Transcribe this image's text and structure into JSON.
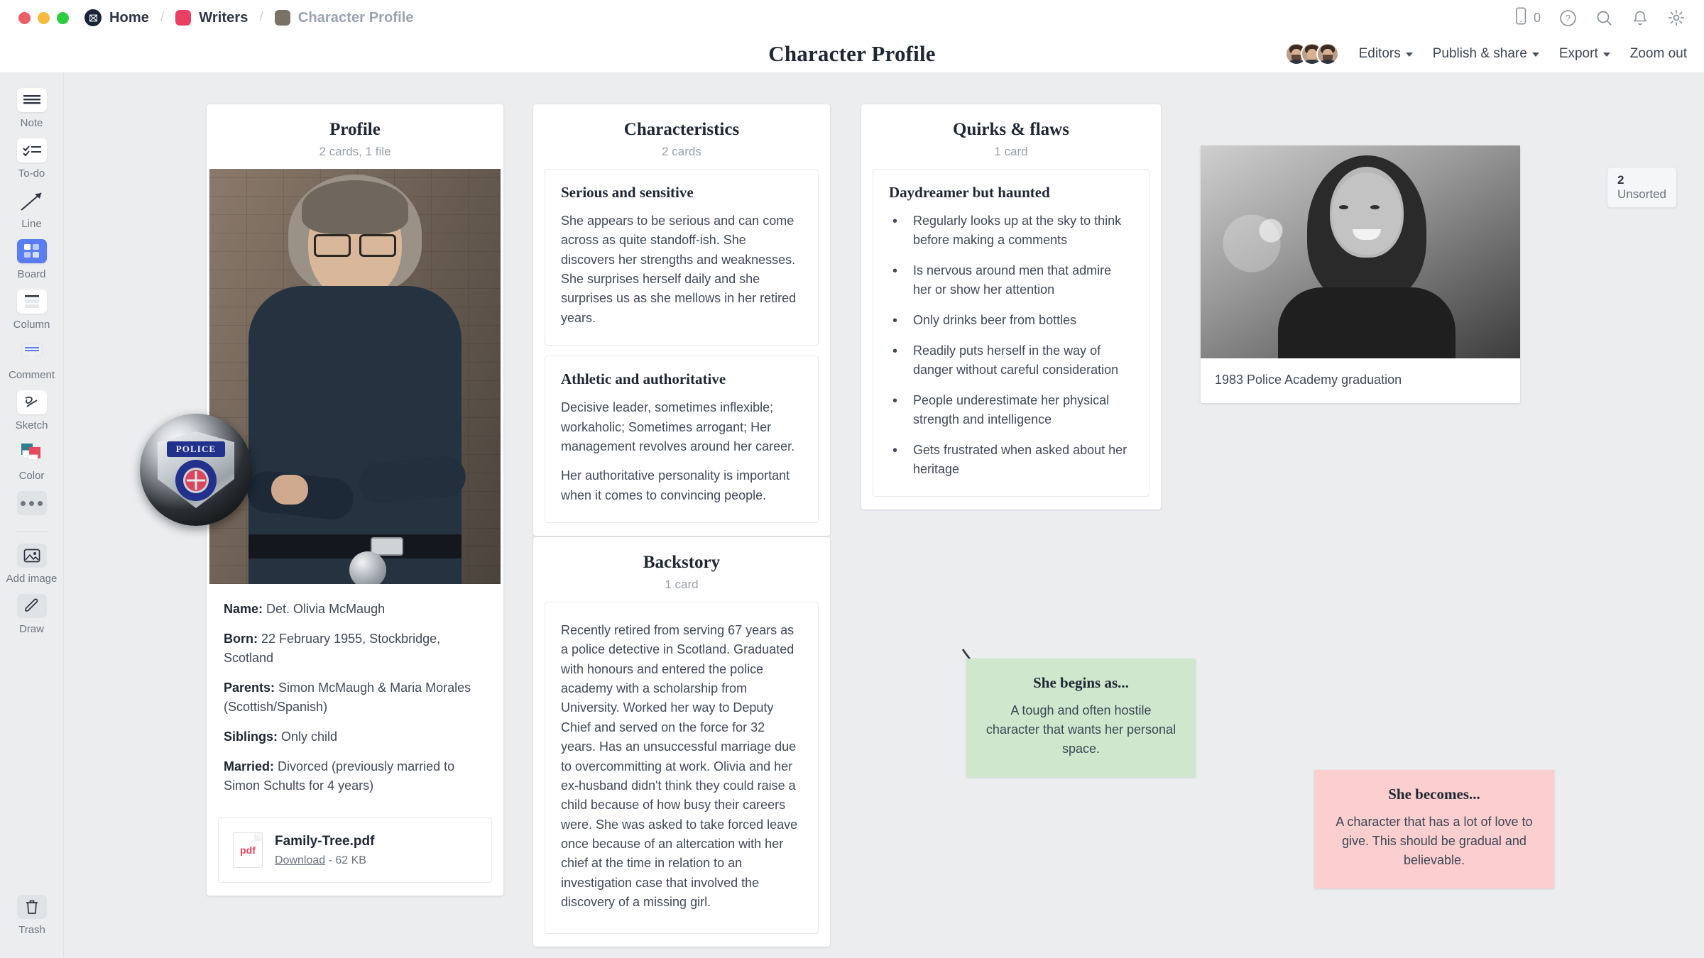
{
  "window": {
    "traffic_lights": [
      "close",
      "minimize",
      "maximize"
    ]
  },
  "breadcrumb": {
    "home": "Home",
    "project": "Writers",
    "current": "Character Profile",
    "separator": "/"
  },
  "topbar_icons": {
    "device_count": "0",
    "help": "help-icon",
    "search": "search-icon",
    "notifications": "bell-icon",
    "settings": "gear-icon"
  },
  "header": {
    "title": "Character Profile",
    "editors": "Editors",
    "publish": "Publish & share",
    "export": "Export",
    "zoom": "Zoom out"
  },
  "toolbar": {
    "items": [
      {
        "label": "Note",
        "icon": "note-icon"
      },
      {
        "label": "To-do",
        "icon": "todo-icon"
      },
      {
        "label": "Line",
        "icon": "line-icon"
      },
      {
        "label": "Board",
        "icon": "board-icon"
      },
      {
        "label": "Column",
        "icon": "column-icon"
      },
      {
        "label": "Comment",
        "icon": "comment-icon"
      },
      {
        "label": "Sketch",
        "icon": "sketch-icon"
      },
      {
        "label": "Color",
        "icon": "color-icon"
      }
    ],
    "more": "more-icon",
    "add_image": "Add image",
    "draw": "Draw",
    "trash": "Trash"
  },
  "board": {
    "unsorted_count": "2",
    "unsorted_label": "Unsorted"
  },
  "columns": [
    {
      "title": "Profile",
      "subtitle": "2 cards, 1 file",
      "meta": [
        {
          "label": "Name:",
          "value": "Det. Olivia McMaugh"
        },
        {
          "label": "Born:",
          "value": "22 February 1955, Stockbridge, Scotland"
        },
        {
          "label": "Parents:",
          "value": "Simon McMaugh & Maria Morales (Scottish/Spanish)"
        },
        {
          "label": "Siblings:",
          "value": "Only child"
        },
        {
          "label": "Married:",
          "value": "Divorced (previously married to Simon Schults for 4 years)"
        }
      ],
      "file": {
        "type": "pdf",
        "name": "Family-Tree.pdf",
        "download": "Download",
        "size": "62 KB",
        "separator": " - "
      }
    },
    {
      "title": "Characteristics",
      "subtitle": "2 cards",
      "cards": [
        {
          "title": "Serious and sensitive",
          "paragraphs": [
            "She appears to be serious and can come across as quite standoff-ish. She discovers her strengths and weaknesses. She surprises herself daily and she surprises us as she mellows in her retired years."
          ]
        },
        {
          "title": "Athletic and authoritative",
          "paragraphs": [
            "Decisive leader, sometimes inflexible; workaholic; Sometimes arrogant; Her management revolves around her career.",
            "Her authoritative personality is important when it comes to convincing people."
          ]
        }
      ]
    },
    {
      "title": "Backstory",
      "subtitle": "1 card",
      "cards": [
        {
          "title": "",
          "paragraphs": [
            "Recently retired from serving 67 years as a police detective in Scotland. Graduated with honours and entered the police academy with a scholarship from University. Worked her way to Deputy Chief and served on the force for 32 years. Has an unsuccessful marriage due to overcommitting at work. Olivia and her ex-husband didn't think they could raise a child because of how busy their careers were. She was asked to take forced leave once because of an altercation with her chief at the time in relation to an investigation case that involved the discovery of a missing girl."
          ]
        }
      ]
    },
    {
      "title": "Quirks & flaws",
      "subtitle": "1 card",
      "cards": [
        {
          "title": "Daydreamer but haunted",
          "bullets": [
            "Regularly looks up at the sky to think before making a comments",
            "Is nervous around men that admire her or show her attention",
            "Only drinks beer from bottles",
            "Readily puts herself in the way of danger without careful consideration",
            "People underestimate her physical strength and intelligence",
            "Gets frustrated when asked about her heritage"
          ]
        }
      ]
    }
  ],
  "photo_card": {
    "caption": "1983 Police Academy graduation"
  },
  "stickies": [
    {
      "title": "She begins as...",
      "body": "A tough and often hostile character that wants her personal space.",
      "color": "#cfe8cd"
    },
    {
      "title": "She becomes...",
      "body": "A character that has a lot of love to give. This should be gradual and believable.",
      "color": "#fbcfd0"
    }
  ],
  "badge_overlay": {
    "text": "POLICE"
  }
}
